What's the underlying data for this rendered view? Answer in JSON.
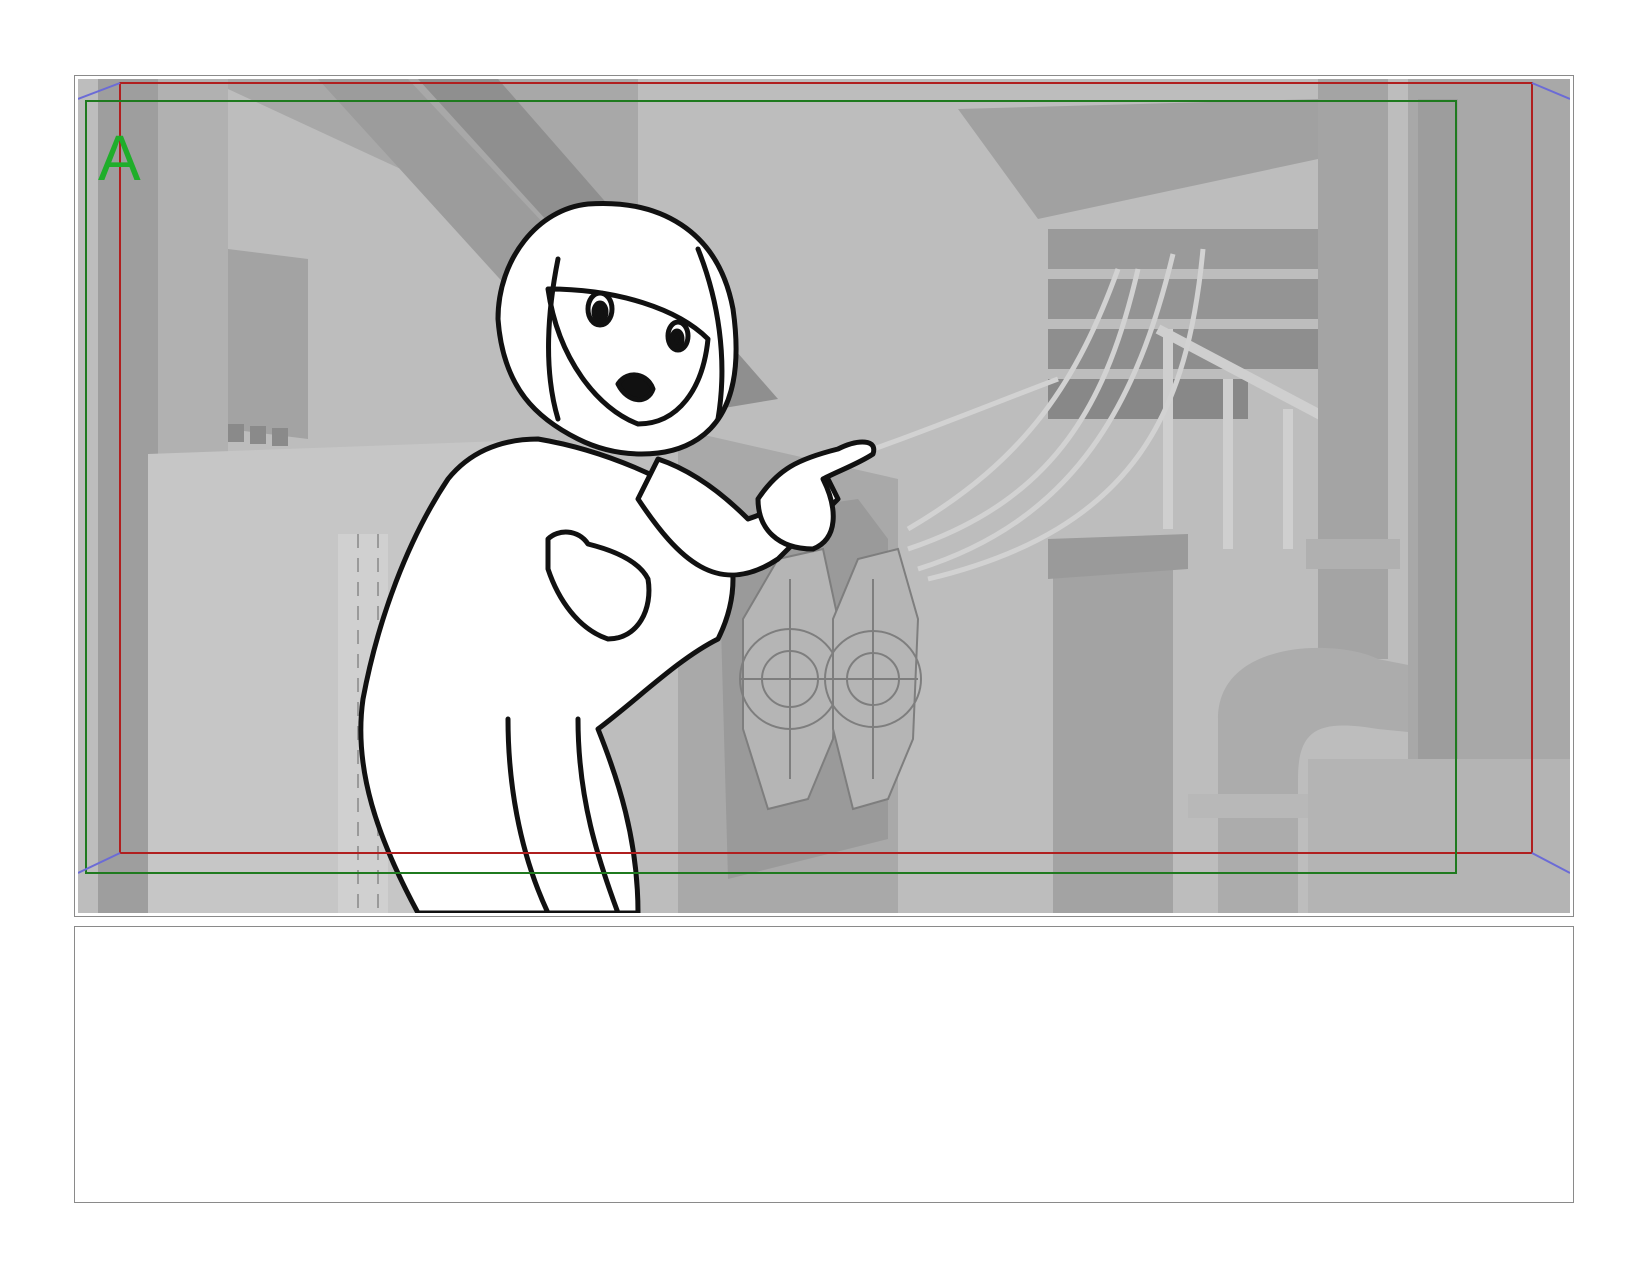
{
  "storyboard": {
    "panel": {
      "shot_label": "A",
      "shot_label_color": "#1fae2a",
      "action_safe_color": "#b01f1f",
      "title_safe_color": "#1f7a1f",
      "camera_guide_color": "#6b6bd6"
    },
    "notes": {
      "text": ""
    }
  }
}
